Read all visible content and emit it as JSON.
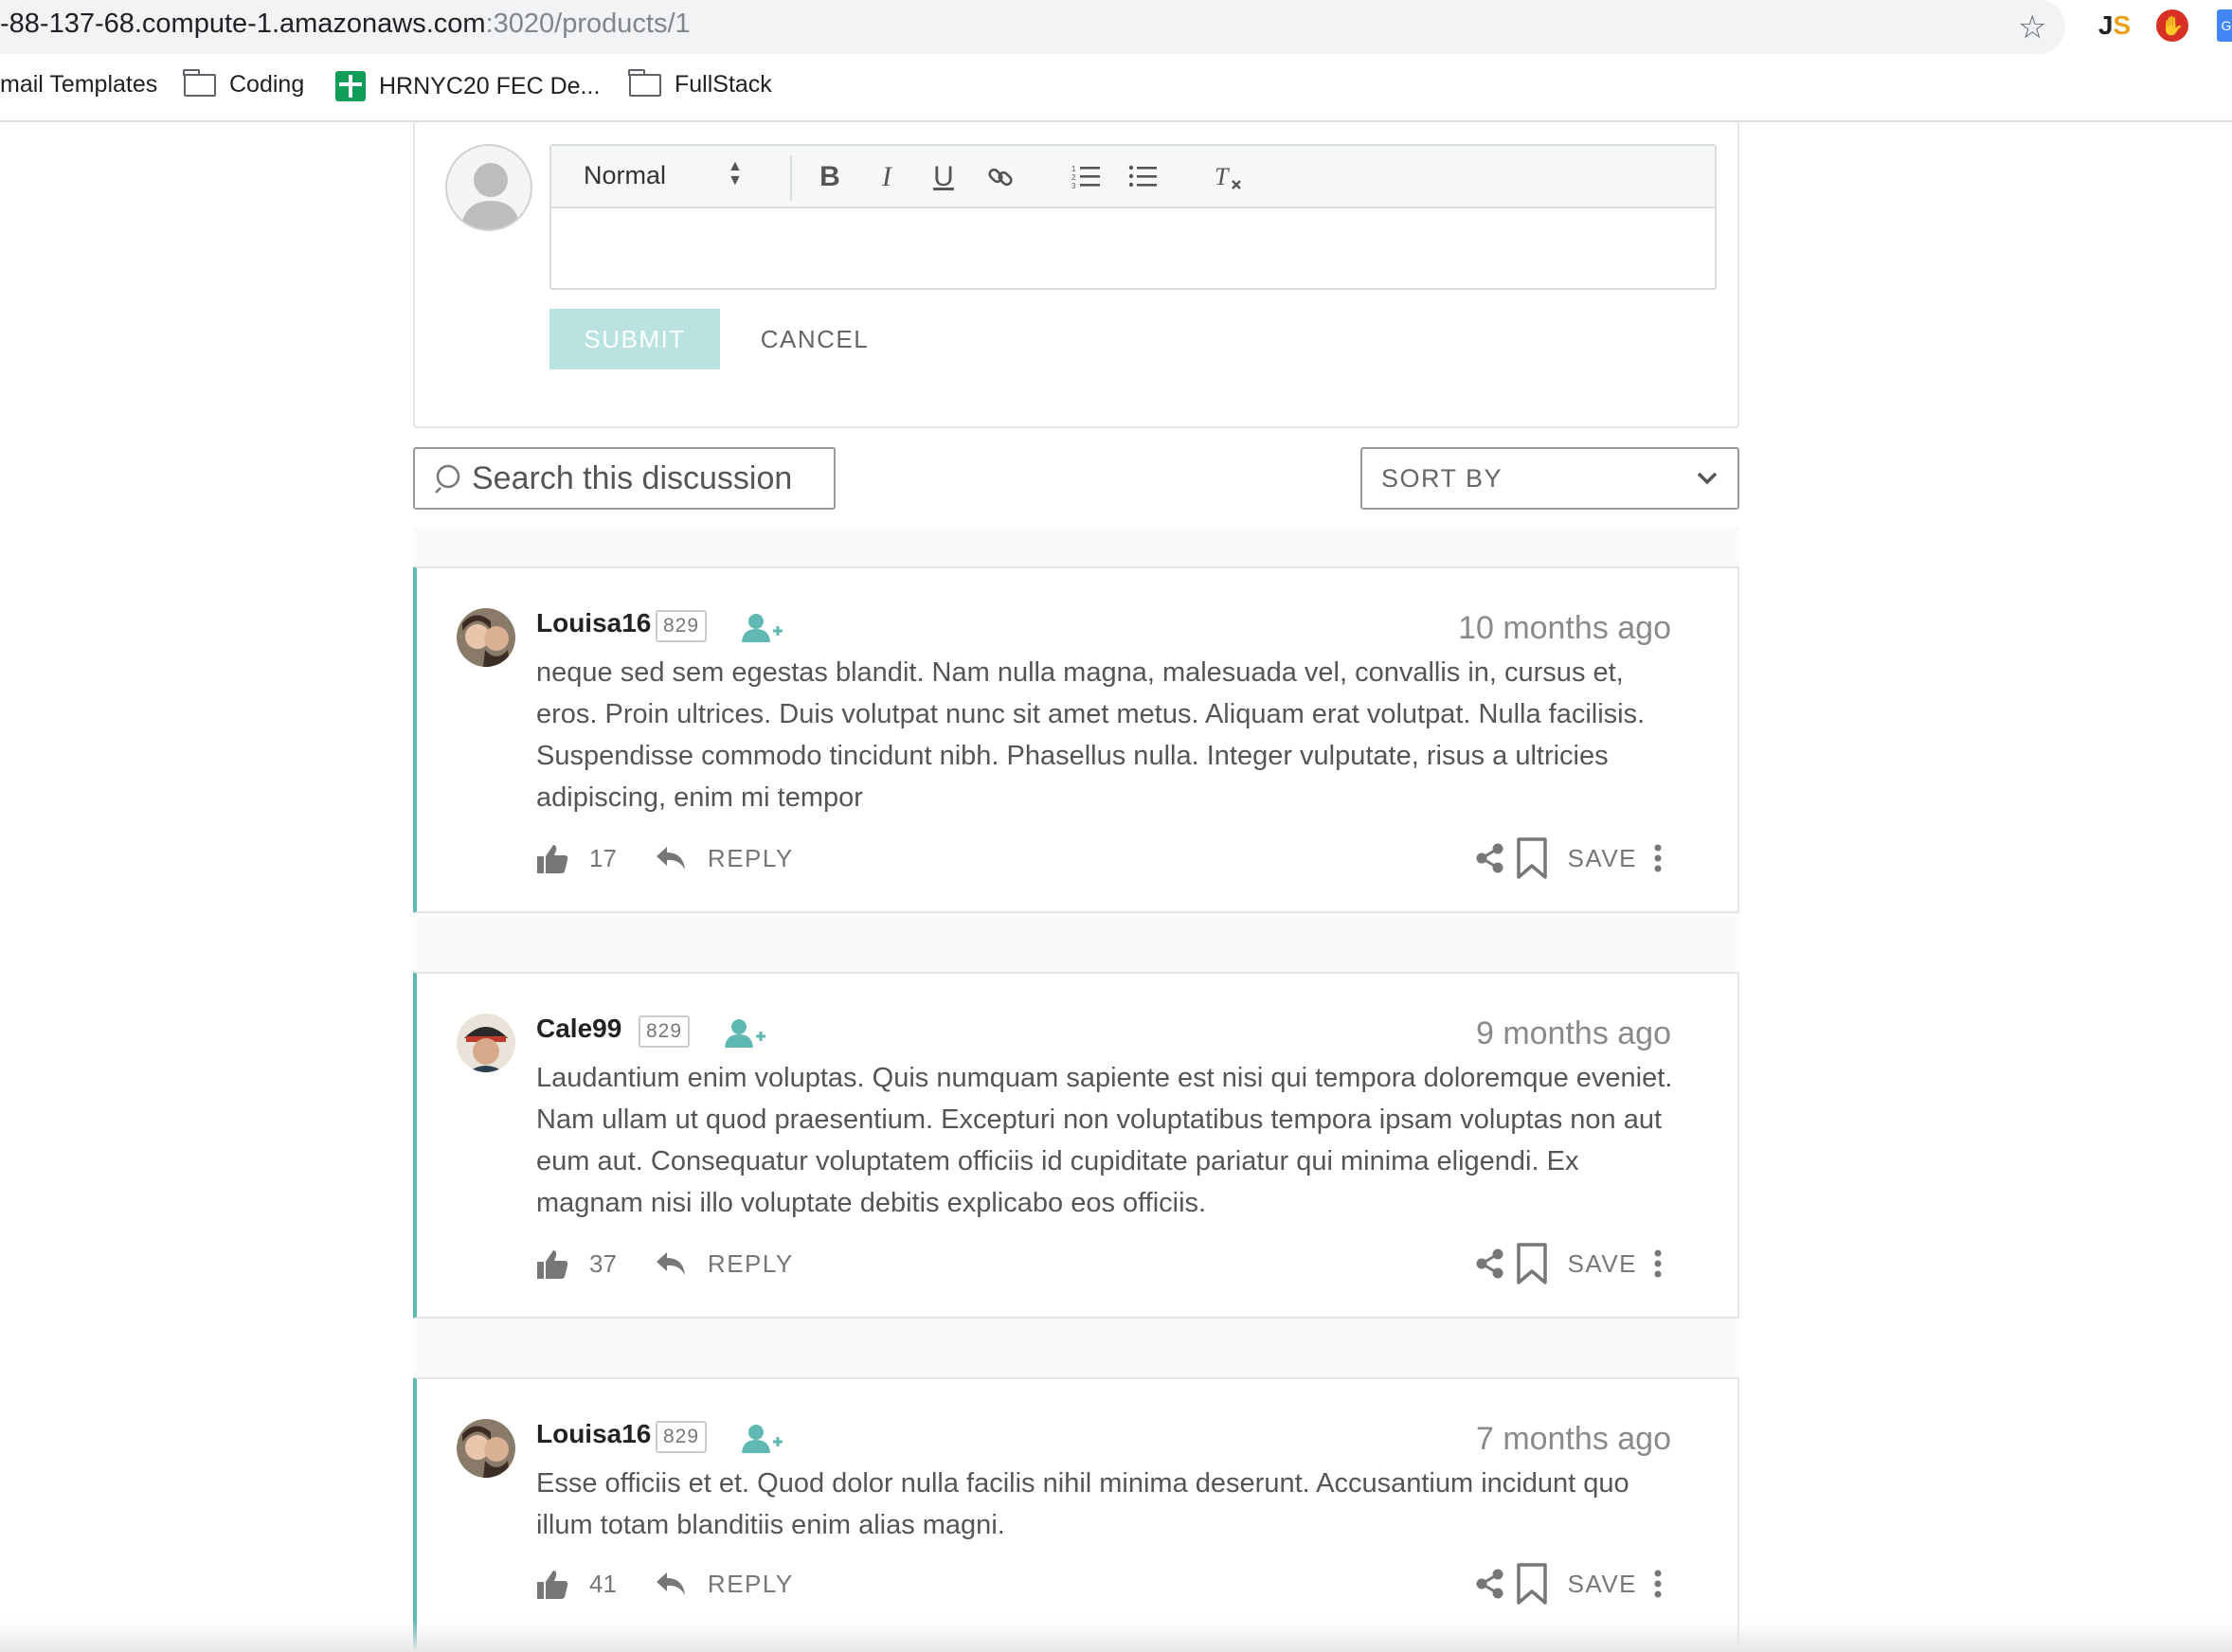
{
  "browser": {
    "url_main": "-88-137-68.compute-1.amazonaws.com",
    "url_rest": ":3020/products/1",
    "extensions": {
      "js": "JS",
      "adblock": "✋",
      "g": "G"
    }
  },
  "bookmarks": [
    {
      "label": "mail Templates",
      "icon": "none"
    },
    {
      "label": "Coding",
      "icon": "folder-icon"
    },
    {
      "label": "HRNYC20 FEC De...",
      "icon": "sheets-icon"
    },
    {
      "label": "FullStack",
      "icon": "folder-icon"
    }
  ],
  "editor": {
    "format_select": "Normal",
    "submit_label": "SUBMIT",
    "cancel_label": "CANCEL",
    "text_value": ""
  },
  "search": {
    "placeholder": "Search this discussion"
  },
  "sort": {
    "label": "SORT BY"
  },
  "colors": {
    "accent": "#5fb8b1",
    "submit_disabled": "#b9e3e0"
  },
  "comments": [
    {
      "user": "Louisa16",
      "badge": "829",
      "time": "10 months ago",
      "text": "neque sed sem egestas blandit. Nam nulla magna, malesuada vel, convallis in, cursus et, eros. Proin ultrices. Duis volutpat nunc sit amet metus. Aliquam erat volutpat. Nulla facilisis. Suspendisse commodo tincidunt nibh. Phasellus nulla. Integer vulputate, risus a ultricies adipiscing, enim mi tempor",
      "votes": "17",
      "reply_label": "REPLY",
      "save_label": "SAVE"
    },
    {
      "user": "Cale99",
      "badge": "829",
      "time": "9 months ago",
      "text": "Laudantium enim voluptas. Quis numquam sapiente est nisi qui tempora doloremque eveniet. Nam ullam ut quod praesentium. Excepturi non voluptatibus tempora ipsam voluptas non aut eum aut. Consequatur voluptatem officiis id cupiditate pariatur qui minima eligendi. Ex magnam nisi illo voluptate debitis explicabo eos officiis.",
      "votes": "37",
      "reply_label": "REPLY",
      "save_label": "SAVE"
    },
    {
      "user": "Louisa16",
      "badge": "829",
      "time": "7 months ago",
      "text": "Esse officiis et et. Quod dolor nulla facilis nihil minima deserunt. Accusantium incidunt quo illum totam blanditiis enim alias magni.",
      "votes": "41",
      "reply_label": "REPLY",
      "save_label": "SAVE"
    }
  ]
}
